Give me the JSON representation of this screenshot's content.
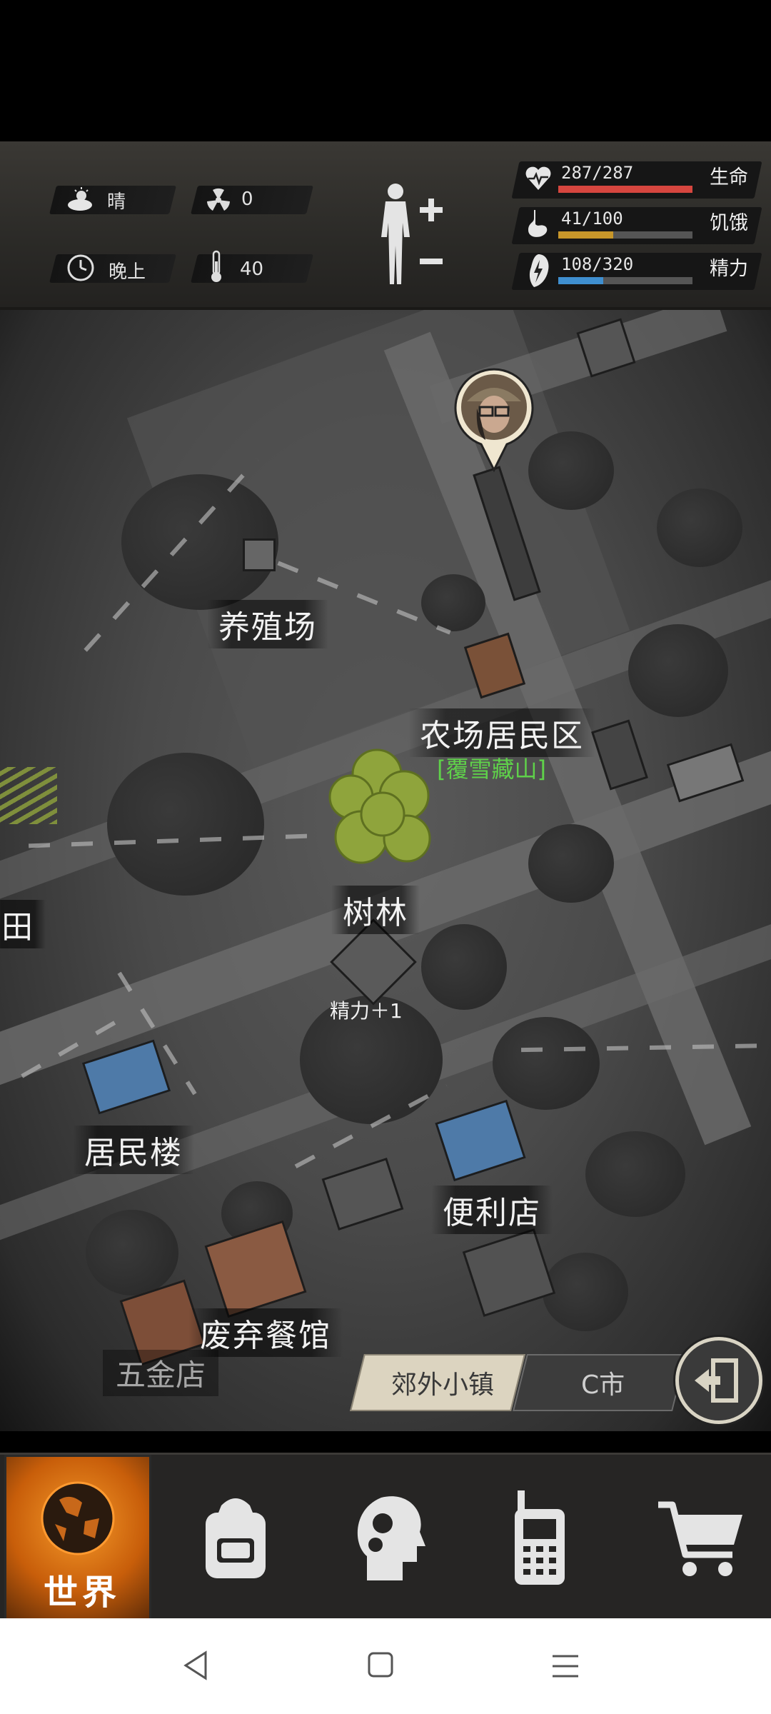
{
  "status": {
    "weather": "晴",
    "radiation": "0",
    "time_of_day": "晚上",
    "temperature": "40",
    "stats": [
      {
        "value": "287/287",
        "label": "生命",
        "fraction": 1.0,
        "color": "#d6463f",
        "icon": "heart-pulse-icon"
      },
      {
        "value": "41/100",
        "label": "饥饿",
        "fraction": 0.41,
        "color": "#c7962a",
        "icon": "stomach-icon"
      },
      {
        "value": "108/320",
        "label": "精力",
        "fraction": 0.3375,
        "color": "#3f8fd0",
        "icon": "energy-icon"
      }
    ],
    "body_icon": "body-figure-icon"
  },
  "map": {
    "places": {
      "farm": "养殖场",
      "farm_residence": "农场居民区",
      "residence_sub": "[覆雪藏山]",
      "forest": "树林",
      "left_edge": "田",
      "apartment": "居民楼",
      "store": "便利店",
      "restaurant": "废弃餐馆",
      "hardware": "五金店"
    },
    "effect_text": "精力＋1",
    "tabs": [
      "郊外小镇",
      "C市"
    ],
    "exit_icon": "exit-door-icon"
  },
  "nav": {
    "world_label": "世界",
    "items": [
      "globe-icon",
      "backpack-icon",
      "skills-head-icon",
      "radio-icon",
      "shopping-cart-icon"
    ]
  },
  "system_nav": [
    "back-icon",
    "home-icon",
    "menu-icon"
  ]
}
